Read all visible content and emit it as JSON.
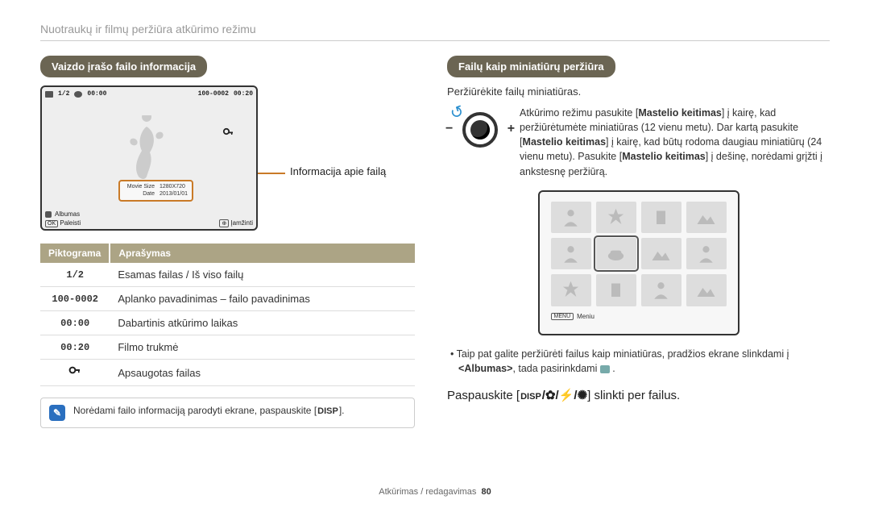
{
  "page": {
    "title": "Nuotraukų ir filmų peržiūra atkūrimo režimu",
    "footer_section": "Atkūrimas / redagavimas",
    "footer_page": "80"
  },
  "left": {
    "heading": "Vaizdo įrašo failo informacija",
    "screen": {
      "counter": "1/2",
      "elapsed": "00:00",
      "file_id": "100-0002",
      "duration": "00:20",
      "info_movie_size_label": "Movie Size",
      "info_movie_size_value": "1280X720",
      "info_date_label": "Date",
      "info_date_value": "2013/01/01",
      "album_label": "Albumas",
      "ok_label": "OK",
      "play_label": "Paleisti",
      "smart_label": "Įamžinti"
    },
    "pointer_label": "Informacija apie failą",
    "table": {
      "col_icon": "Piktograma",
      "col_desc": "Aprašymas",
      "rows": [
        {
          "icon": "1/2",
          "desc": "Esamas failas / Iš viso failų"
        },
        {
          "icon": "100-0002",
          "desc": "Aplanko pavadinimas – failo pavadinimas"
        },
        {
          "icon": "00:00",
          "desc": "Dabartinis atkūrimo laikas"
        },
        {
          "icon": "00:20",
          "desc": "Filmo trukmė"
        },
        {
          "icon": "KEY",
          "desc": "Apsaugotas failas"
        }
      ]
    },
    "note": "Norėdami failo informaciją parodyti ekrane, paspauskite [",
    "note_disp": "DISP",
    "note_end": "]."
  },
  "right": {
    "heading": "Failų kaip miniatiūrų peržiūra",
    "intro": "Peržiūrėkite failų miniatiūras.",
    "zoom_text_1": "Atkūrimo režimu pasukite [",
    "zoom_bold_1": "Mastelio keitimas",
    "zoom_text_2": "] į kairę, kad peržiūrėtumėte miniatiūras (12 vienu metu). Dar kartą pasukite [",
    "zoom_bold_2": "Mastelio keitimas",
    "zoom_text_3": "] į kairę, kad būtų rodoma daugiau miniatiūrų (24 vienu metu). Pasukite [",
    "zoom_bold_3": "Mastelio keitimas",
    "zoom_text_4": "] į dešinę, norėdami grįžti į ankstesnę peržiūrą.",
    "thumb_footer_menu": "MENU",
    "thumb_footer_label": "Meniu",
    "bullet": "Taip pat galite peržiūrėti failus kaip miniatiūras, pradžios ekrane slinkdami į ",
    "bullet_album": "<Albumas>",
    "bullet_end": ", tada pasirinkdami ",
    "instruction_pre": "Paspauskite [",
    "instruction_disp": "DISP",
    "instruction_post": "] slinkti per failus."
  }
}
